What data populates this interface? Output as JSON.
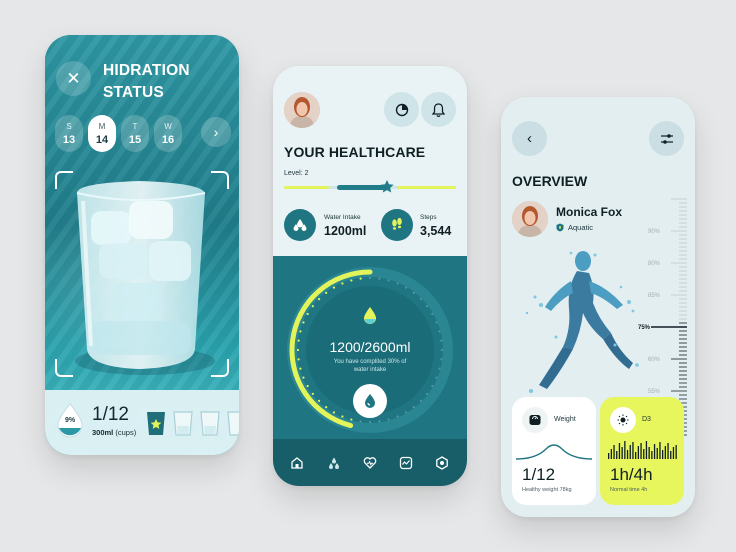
{
  "hydration_screen": {
    "title": "HIDRATION STATUS",
    "close_icon": "close-icon",
    "next_icon": "chevron-right-icon",
    "days": [
      {
        "letter": "S",
        "number": "13",
        "active": false
      },
      {
        "letter": "M",
        "number": "14",
        "active": true
      },
      {
        "letter": "T",
        "number": "15",
        "active": false
      },
      {
        "letter": "W",
        "number": "16",
        "active": false
      }
    ],
    "percent": "9%",
    "cups_count": "1/12",
    "cups_amount": "300ml",
    "cups_unit": "(cups)",
    "cups_filled": 1,
    "cups_total_shown": 4
  },
  "healthcare_screen": {
    "title": "YOUR HEALTHCARE",
    "level_label": "Level: 2",
    "water_intake_label": "Water Intake",
    "water_intake_value": "1200ml",
    "steps_label": "Steps",
    "steps_value": "3,544",
    "intake_amount": "1200/2600ml",
    "intake_subtitle": "You have complited 30% of water intake",
    "intake_fraction": 0.46,
    "icons": [
      "chart-icon",
      "bell-icon",
      "drops-icon",
      "footsteps-icon",
      "water-drop-icon"
    ],
    "nav": [
      "home-icon",
      "drops-icon",
      "heart-icon",
      "activity-icon",
      "settings-icon"
    ]
  },
  "overview_screen": {
    "title": "OVERVIEW",
    "name": "Monica Fox",
    "tag": "Aquatic",
    "ruler_labels": [
      "90%",
      "80%",
      "85%",
      "75%",
      "60%",
      "55%"
    ],
    "ruler_selected": "75%",
    "weight_label": "Weight",
    "weight_value": "1/12",
    "weight_sub": "Healthy weight 78kg",
    "d3_label": "D3",
    "d3_value": "1h/4h",
    "d3_sub": "Normal time 4h"
  },
  "colors": {
    "teal": "#1f7582",
    "teal_dark": "#175e69",
    "lime": "#e3f45a",
    "background": "#e6e7e8"
  }
}
